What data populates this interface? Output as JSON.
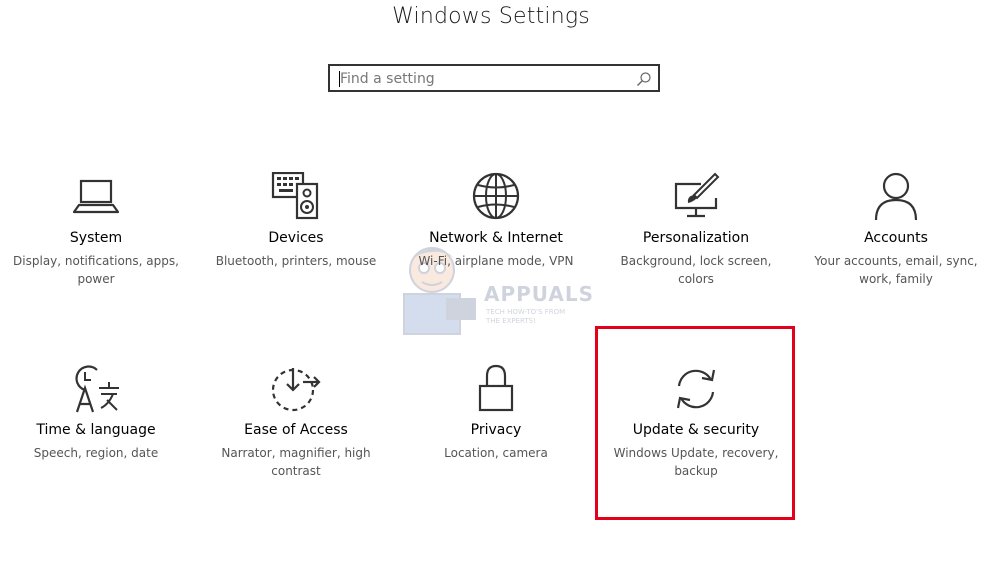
{
  "window": {
    "title": "Windows Settings"
  },
  "search": {
    "placeholder": "Find a setting",
    "value": ""
  },
  "tiles": [
    {
      "label": "System",
      "desc": "Display, notifications, apps, power",
      "icon": "laptop-icon"
    },
    {
      "label": "Devices",
      "desc": "Bluetooth, printers, mouse",
      "icon": "devices-icon"
    },
    {
      "label": "Network & Internet",
      "desc": "Wi-Fi, airplane mode, VPN",
      "icon": "globe-icon"
    },
    {
      "label": "Personalization",
      "desc": "Background, lock screen, colors",
      "icon": "paintbrush-monitor-icon"
    },
    {
      "label": "Accounts",
      "desc": "Your accounts, email, sync, work, family",
      "icon": "person-icon"
    },
    {
      "label": "Time & language",
      "desc": "Speech, region, date",
      "icon": "time-language-icon"
    },
    {
      "label": "Ease of Access",
      "desc": "Narrator, magnifier, high contrast",
      "icon": "ease-of-access-icon"
    },
    {
      "label": "Privacy",
      "desc": "Location, camera",
      "icon": "lock-icon"
    },
    {
      "label": "Update & security",
      "desc": "Windows Update, recovery, backup",
      "icon": "sync-arrows-icon"
    }
  ],
  "highlight": {
    "target": "Update & security",
    "color": "#e2001a"
  },
  "watermark": {
    "brand": "APPUALS",
    "tagline": "TECH HOW-TO'S FROM THE EXPERTS!"
  },
  "colors": {
    "icon_stroke": "#333333",
    "label": "#000000",
    "description": "#555555"
  }
}
